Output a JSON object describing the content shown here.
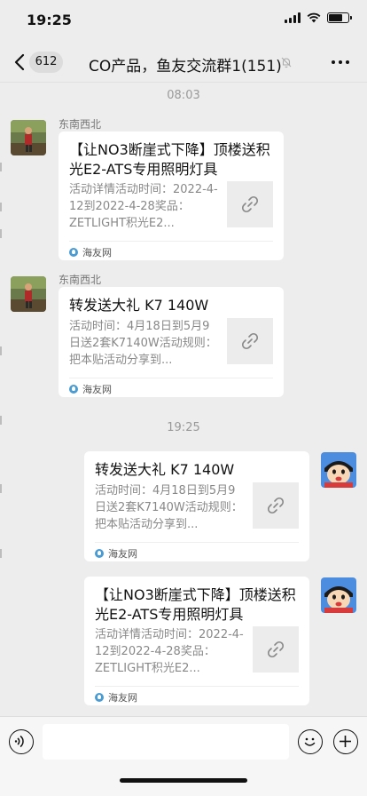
{
  "status_bar": {
    "time": "19:25"
  },
  "header": {
    "back_icon": "chevron-left-icon",
    "unread_count": "612",
    "title": "CO产品，鱼友交流群1(151)",
    "mute_icon": "bell-off-icon",
    "more_icon": "more-dots-icon"
  },
  "messages": [
    {
      "type": "timestamp",
      "text": "08:03"
    },
    {
      "type": "card",
      "side": "left",
      "sender": "东南西北",
      "title": "【让NO3断崖式下降】顶楼送积光E2-ATS专用照明灯具",
      "desc": "活动详情活动时间：2022-4-12到2022-4-28奖品：ZETLIGHT积光E2...",
      "source": "海友网"
    },
    {
      "type": "card",
      "side": "left",
      "sender": "东南西北",
      "title": "转发送大礼 K7 140W",
      "desc": "活动时间：4月18日到5月9日送2套K7140W活动规则：把本贴活动分享到...",
      "source": "海友网"
    },
    {
      "type": "timestamp",
      "text": "19:25"
    },
    {
      "type": "card",
      "side": "right",
      "title": "转发送大礼 K7 140W",
      "desc": "活动时间：4月18日到5月9日送2套K7140W活动规则：把本贴活动分享到...",
      "source": "海友网"
    },
    {
      "type": "card",
      "side": "right",
      "title": "【让NO3断崖式下降】顶楼送积光E2-ATS专用照明灯具",
      "desc": "活动详情活动时间：2022-4-12到2022-4-28奖品：ZETLIGHT积光E2...",
      "source": "海友网"
    }
  ],
  "input_bar": {
    "voice_icon": "voice-icon",
    "emoji_icon": "emoji-icon",
    "plus_icon": "plus-icon"
  },
  "colors": {
    "background": "#ededed",
    "card": "#ffffff",
    "muted_text": "#888888",
    "timestamp": "#999999"
  }
}
